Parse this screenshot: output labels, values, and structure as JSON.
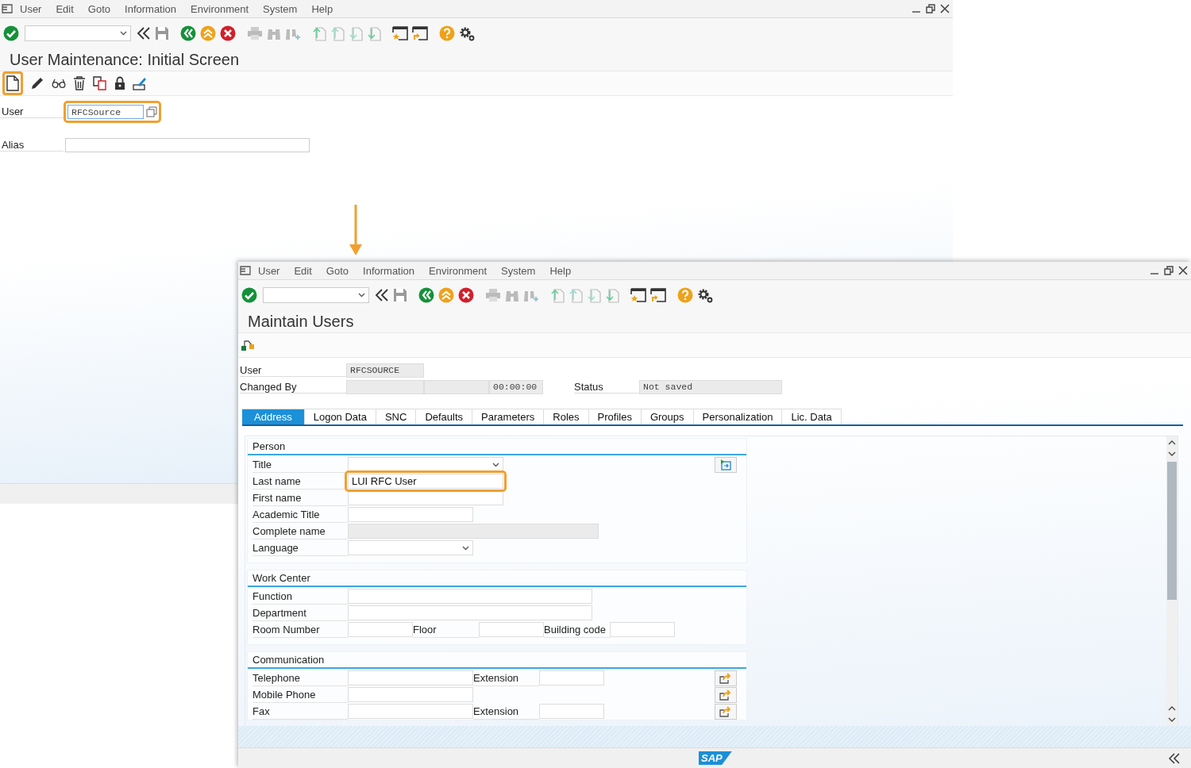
{
  "initial_screen": {
    "menu": [
      "User",
      "Edit",
      "Goto",
      "Information",
      "Environment",
      "System",
      "Help"
    ],
    "title": "User Maintenance: Initial Screen",
    "create_button": {
      "highlighted": true
    },
    "fields": [
      {
        "label": "User",
        "value": "RFCSource",
        "kind": "search",
        "highlighted": true
      },
      {
        "label": "Alias",
        "kind": "text",
        "highlighted": false
      }
    ]
  },
  "maintain_users": {
    "menu": [
      "User",
      "Edit",
      "Goto",
      "Information",
      "Environment",
      "System",
      "Help"
    ],
    "title": "Maintain Users",
    "header": {
      "user_label": "User",
      "user_value": "RFCSOURCE",
      "changed_by_label": "Changed By",
      "changed_time": "00:00:00",
      "status_label": "Status",
      "status_value": "Not saved"
    },
    "tabs": [
      {
        "label": "Address",
        "selected": true
      },
      {
        "label": "Logon Data",
        "selected": false
      },
      {
        "label": "SNC",
        "selected": false
      },
      {
        "label": "Defaults",
        "selected": false
      },
      {
        "label": "Parameters",
        "selected": false
      },
      {
        "label": "Roles",
        "selected": false
      },
      {
        "label": "Profiles",
        "selected": false
      },
      {
        "label": "Groups",
        "selected": false
      },
      {
        "label": "Personalization",
        "selected": false
      },
      {
        "label": "Lic. Data",
        "selected": false
      }
    ],
    "sections": [
      {
        "title": "Person",
        "rows": [
          {
            "button": true,
            "fields": [
              {
                "label": "Title",
                "kind": "dropdown",
                "highlighted": false
              }
            ]
          },
          {
            "button": false,
            "fields": [
              {
                "label": "Last name",
                "kind": "text",
                "value": "LUI RFC User",
                "highlighted": true
              }
            ]
          },
          {
            "button": false,
            "fields": [
              {
                "label": "First name",
                "kind": "text",
                "highlighted": false
              }
            ]
          },
          {
            "button": false,
            "fields": [
              {
                "label": "Academic Title",
                "kind": "text",
                "highlighted": false
              }
            ]
          },
          {
            "button": false,
            "fields": [
              {
                "label": "Complete name",
                "kind": "readonly",
                "highlighted": false
              }
            ]
          },
          {
            "button": false,
            "fields": [
              {
                "label": "Language",
                "kind": "dropdown",
                "highlighted": false
              }
            ]
          }
        ]
      },
      {
        "title": "Work Center",
        "rows": [
          {
            "button": false,
            "fields": [
              {
                "label": "Function",
                "kind": "text",
                "highlighted": false
              }
            ]
          },
          {
            "button": false,
            "fields": [
              {
                "label": "Department",
                "kind": "text",
                "highlighted": false
              }
            ]
          },
          {
            "button": false,
            "fields": [
              {
                "label": "Room Number",
                "kind": "text",
                "highlighted": false
              },
              {
                "label": "Floor",
                "kind": "text",
                "highlighted": false
              },
              {
                "label": "Building code",
                "kind": "text",
                "highlighted": false
              }
            ]
          }
        ]
      },
      {
        "title": "Communication",
        "rows": [
          {
            "button": true,
            "fields": [
              {
                "label": "Telephone",
                "kind": "text",
                "highlighted": false
              },
              {
                "label": "Extension",
                "kind": "text",
                "highlighted": false
              }
            ]
          },
          {
            "button": true,
            "fields": [
              {
                "label": "Mobile Phone",
                "kind": "text",
                "highlighted": false
              }
            ]
          },
          {
            "button": true,
            "fields": [
              {
                "label": "Fax",
                "kind": "text",
                "highlighted": false
              },
              {
                "label": "Extension",
                "kind": "text",
                "highlighted": false
              }
            ]
          }
        ]
      }
    ],
    "logo": "SAP"
  }
}
